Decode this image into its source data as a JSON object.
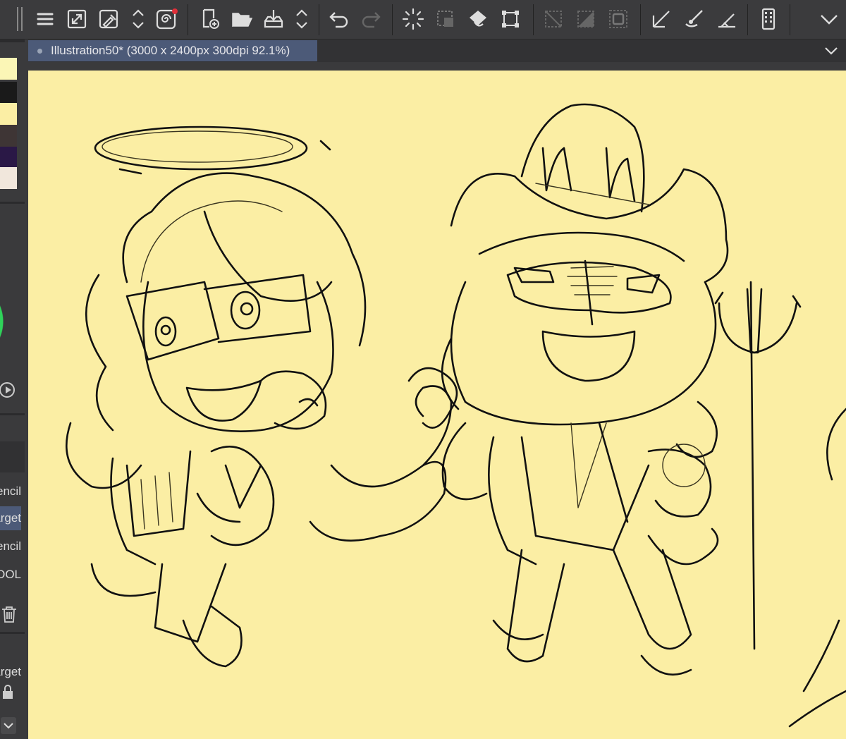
{
  "app": {
    "document_tab": {
      "title": "Illustration50* (3000 x 2400px 300dpi 92.1%)"
    }
  },
  "toolbar": {
    "items": [
      "menu-icon",
      "resize-canvas-icon",
      "eyedropper-icon",
      "up-down-arrows-icon",
      "spiral-icon",
      "new-file-icon",
      "open-folder-icon",
      "save-download-icon",
      "up-down-arrows-icon",
      "undo-icon",
      "redo-icon",
      "spinner-icon",
      "selection-icon",
      "fill-icon",
      "transform-icon",
      "deselect-icon",
      "invert-selection-icon",
      "selection-border-icon",
      "ruler-icon",
      "brush-stroke-icon",
      "pen-ruler-icon",
      "device-icon",
      "chevron-down-icon"
    ]
  },
  "left_panel": {
    "swatch_colors": [
      "#fbf6b6",
      "#1a1a1a",
      "#fbeea4",
      "#3e3535",
      "#2a1846",
      "#f1e7dc"
    ],
    "color_wheel_accent": "#2fd35a",
    "tool_labels": [
      {
        "text": "Pencil",
        "active": false
      },
      {
        "text": "Target",
        "active": true
      },
      {
        "text": "Pencil",
        "active": false
      },
      {
        "text": "TOOL",
        "active": false
      }
    ],
    "sub_tool_label": "Target"
  },
  "canvas": {
    "background": "#fbeea4"
  }
}
